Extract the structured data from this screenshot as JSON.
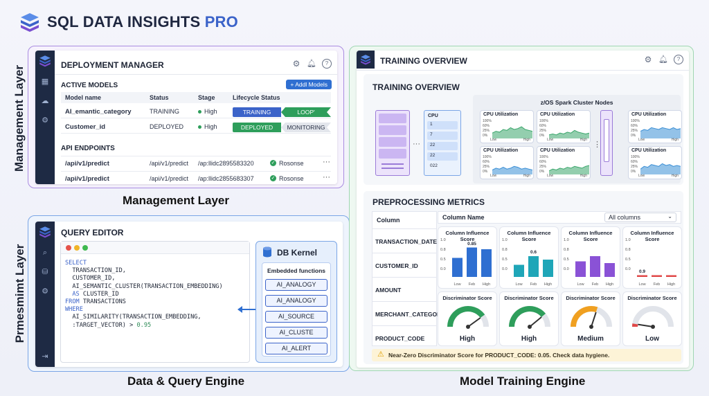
{
  "brand": {
    "title_main": "SQL DATA INSIGHTS",
    "title_pro": "PRO"
  },
  "side_labels": {
    "management": "Management Layer",
    "preprocessing": "Prmesmimt Layer"
  },
  "captions": {
    "management": "Management Layer",
    "data_query": "Data & Query Engine",
    "model_training": "Model Training Engine"
  },
  "deployment": {
    "title": "DEPLOYMENT MANAGER",
    "active_models_label": "ACTIVE MODELS",
    "add_button": "+ Addl Models",
    "columns": [
      "Model name",
      "Status",
      "Stage",
      "Lifecycle Status"
    ],
    "models": [
      {
        "name": "AI_emantic_category",
        "status": "TRAINING",
        "stage": "High",
        "stage_color": "#2e9e5b",
        "lifecycle_left": "TRAINING",
        "lifecycle_right": "LOOP'",
        "left_color": "#3b63c9",
        "right_color": "#2e9e5b"
      },
      {
        "name": "Customer_id",
        "status": "DEPLOYED",
        "stage": "High",
        "stage_color": "#2e9e5b",
        "lifecycle_left": "DEPLOYED",
        "lifecycle_right": "MONITORING",
        "left_color": "#2e9e5b",
        "right_color": "#e3e6ec"
      }
    ],
    "api_label": "API ENDPOINTS",
    "endpoints": [
      {
        "name": "/api/v1/predict",
        "path": "/api/v1/predict",
        "id": "/ap:llidc2895583320",
        "status": "Rosonse"
      },
      {
        "name": "/api/v1/predict",
        "path": "/api/v1/predict",
        "id": "/ap:llidc2855683307",
        "status": "Rosonse"
      }
    ]
  },
  "query_editor": {
    "title": "QUERY EDITOR",
    "code_lines": [
      {
        "kw": "SELECT",
        "text": ""
      },
      {
        "kw": "",
        "text": "  TRANSACTION_ID,"
      },
      {
        "kw": "",
        "text": "  CUSTOMER_ID,"
      },
      {
        "kw": "",
        "text": "  AI_SEMANTIC_CLUSTER(TRANSACTION_EMBEDDING)"
      },
      {
        "kw": "  AS",
        "text": " CLUSTER_ID"
      },
      {
        "kw": "FROM",
        "text": " TRANSACTIONS"
      },
      {
        "kw": "WHERE",
        "text": ""
      },
      {
        "kw": "",
        "text": "  AI_SIMILARITY(TRANSACTION_EMBEDDING,"
      },
      {
        "kw": "",
        "text": "  :TARGET_VECTOR) > ",
        "num": "0.95"
      }
    ],
    "kernel_title": "DB Kernel",
    "embedded_label": "Embedded functions",
    "functions": [
      "AI_ANALOGY",
      "AI_ANALOGY",
      "AI_SOURCE",
      "AI_CLUSTE",
      "AI_ALERT"
    ]
  },
  "training": {
    "window_title": "TRAINING OVERVIEW",
    "section_title": "TRAINING OVERVIEW",
    "cluster_title": "z/OS Spark Cluster Nodes",
    "cpu_label": "CPU",
    "cpu_rows": [
      "1",
      "7",
      "22",
      "22",
      "022"
    ],
    "cpu_card_title": "CPU Utilization",
    "cpu_pct": [
      "100%",
      "60%",
      "25%",
      "0%"
    ],
    "low": "Low",
    "high": "High",
    "cards": [
      {
        "color": "#3aa66b"
      },
      {
        "color": "#3aa66b"
      },
      {
        "color": "#3a8fd6"
      },
      {
        "color": "#3aa66b"
      },
      {
        "color": "#3a8fd6"
      },
      {
        "color": "#3a8fd6"
      }
    ]
  },
  "preprocessing": {
    "title": "PREPROCESSING METRICS",
    "col_header": "Column",
    "colname_header": "Column Name",
    "select_value": "All columns",
    "columns": [
      "TRANSACTION_DATE",
      "CUSTOMER_ID",
      "AMOUNT",
      "MERCHANT_CATEGORY",
      "PRODUCT_CODE"
    ],
    "influence_title": "Column Influence Score",
    "discriminator_title": "Discriminator Score",
    "bar_categories": [
      "Low",
      "Feb",
      "High"
    ],
    "influence": [
      {
        "color": "#2f6fd1",
        "values": [
          0.55,
          0.85,
          0.8
        ],
        "label": "0.85",
        "ticks": [
          "1.0",
          "0.8",
          "0.5",
          "0.0"
        ]
      },
      {
        "color": "#1fa6b8",
        "values": [
          0.35,
          0.6,
          0.5
        ],
        "label": "0.6",
        "ticks": [
          "1.0",
          "0.8",
          "0.5",
          "0.0"
        ]
      },
      {
        "color": "#8a52d6",
        "values": [
          0.45,
          0.6,
          0.4
        ],
        "label": "",
        "ticks": [
          "1.0",
          "0.8",
          "0.5",
          "0.0"
        ]
      },
      {
        "color": "#e04848",
        "values": [
          0.05,
          0.05,
          0.05
        ],
        "label": "0.9",
        "ticks": [
          "1.0",
          "0.8",
          "0.5",
          "0.0"
        ]
      }
    ],
    "gauges": [
      {
        "label": "High",
        "color": "#2e9e5b",
        "value": 0.8
      },
      {
        "label": "High",
        "color": "#2e9e5b",
        "value": 0.78
      },
      {
        "label": "Medium",
        "color": "#f0a020",
        "value": 0.6
      },
      {
        "label": "Low",
        "color": "#e04848",
        "value": 0.05
      }
    ],
    "warning": "Near-Zero Discriminator Score for PRODUCT_CODE: 0.05. Check data hygiene."
  }
}
